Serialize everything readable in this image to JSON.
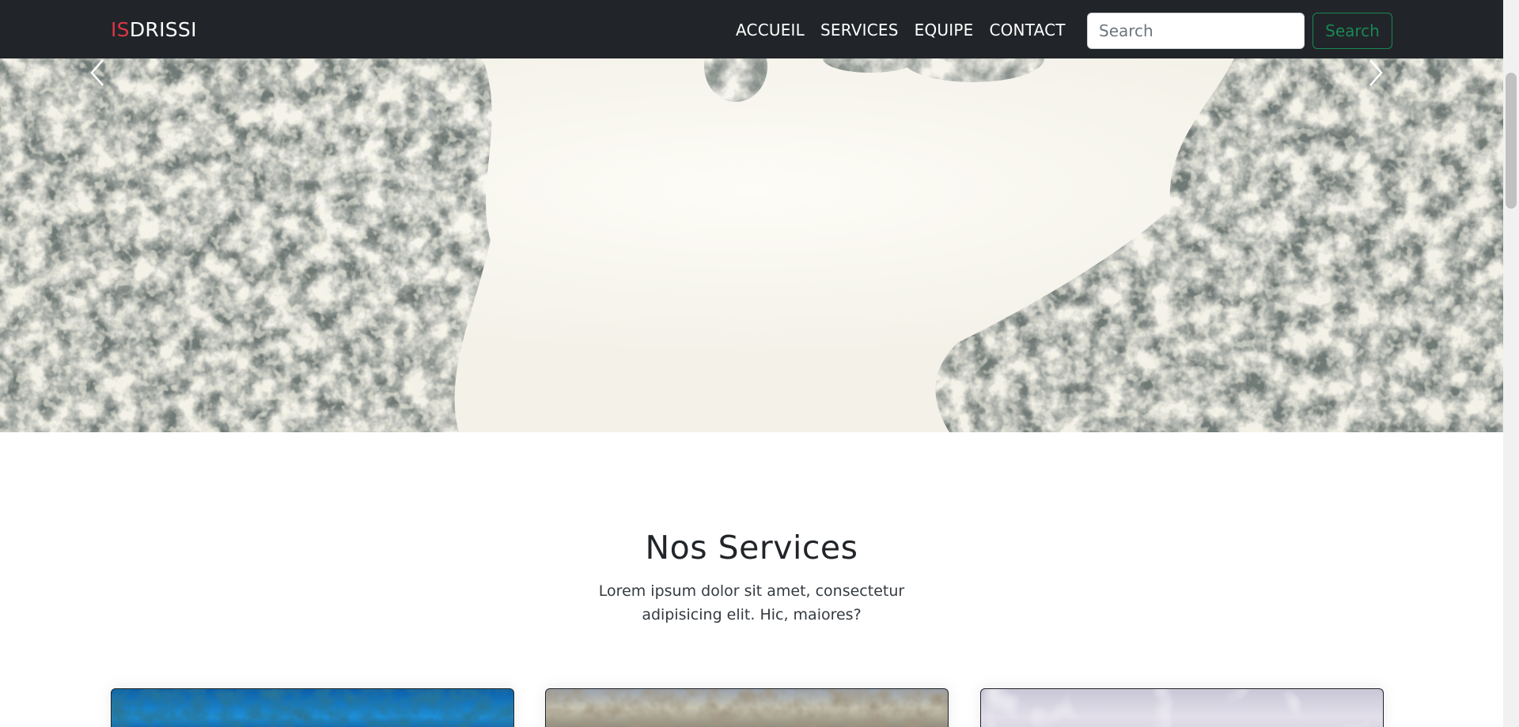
{
  "navbar": {
    "brand_accent": "IS",
    "brand_rest": "DRISSI",
    "links": [
      "ACCUEIL",
      "SERVICES",
      "EQUIPE",
      "CONTACT"
    ],
    "search_placeholder": "Search",
    "search_button": "Search"
  },
  "hero": {
    "prev_icon": "chevron-left-icon",
    "next_icon": "chevron-right-icon"
  },
  "services": {
    "title": "Nos Services",
    "subtitle": "Lorem ipsum dolor sit amet, consectetur adipisicing elit. Hic, maiores?"
  },
  "colors": {
    "navbar_bg": "#212529",
    "brand_accent": "#dc3545",
    "search_button": "#198754"
  }
}
